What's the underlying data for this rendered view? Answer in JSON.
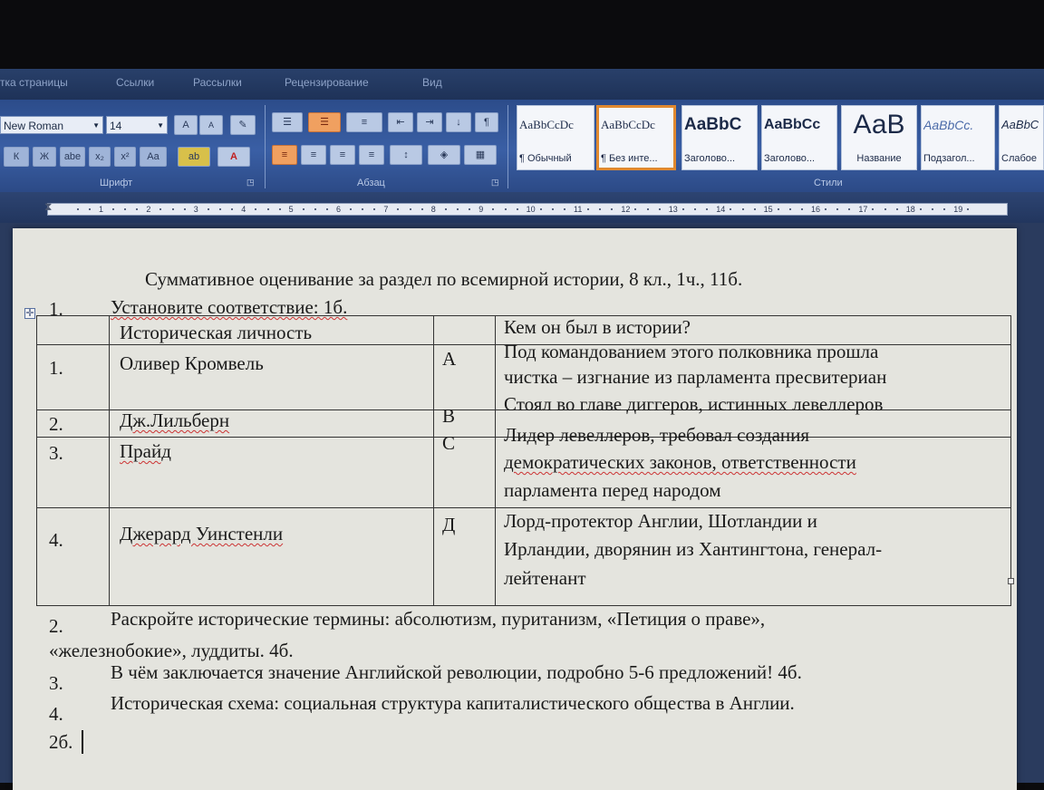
{
  "ribbon": {
    "tabs": [
      "тка страницы",
      "Ссылки",
      "Рассылки",
      "Рецензирование",
      "Вид"
    ],
    "font": {
      "name": "New Roman",
      "size": "14",
      "grow_label": "A",
      "shrink_label": "A",
      "format_buttons": [
        "Ж",
        "К",
        "abe",
        "x₂",
        "x²",
        "Aa"
      ],
      "highlight_label": "ab",
      "color_label": "A",
      "group_label": "Шрифт"
    },
    "paragraph": {
      "group_label": "Абзац"
    },
    "styles": {
      "group_label": "Стили",
      "items": [
        {
          "preview": "AaBbCcDc",
          "name": "¶ Обычный"
        },
        {
          "preview": "AaBbCcDc",
          "name": "¶ Без инте..."
        },
        {
          "preview": "AaBbC",
          "name": "Заголово..."
        },
        {
          "preview": "AaBbCc",
          "name": "Заголово..."
        },
        {
          "preview": "АаВ",
          "name": "Название"
        },
        {
          "preview": "AaBbCc.",
          "name": "Подзагол..."
        },
        {
          "preview": "AaBbC",
          "name": "Слабое"
        }
      ]
    }
  },
  "ruler": {
    "numbers": [
      "1",
      "2",
      "3",
      "4",
      "5",
      "6",
      "7",
      "8",
      "9",
      "10",
      "11",
      "12",
      "13",
      "14",
      "15",
      "16",
      "17",
      "18",
      "19"
    ]
  },
  "document": {
    "title": "Суммативное оценивание за раздел по всемирной истории, 8 кл., 1ч., 11б.",
    "task1": {
      "num": "1.",
      "text": "Установите соответствие: 1б."
    },
    "table": {
      "headers": {
        "person": "Историческая личность",
        "role": "Кем он был в истории?"
      },
      "rows": [
        {
          "num": "1.",
          "name": "Оливер Кромвель",
          "letter": "А",
          "desc": [
            "Под командованием этого полковника прошла",
            "чистка – изгнание из парламента пресвитериан"
          ]
        },
        {
          "num": "2.",
          "name": "Дж.Лильберн",
          "letter": "В",
          "desc": [
            "Стоял во главе диггеров, истинных левеллеров"
          ]
        },
        {
          "num": "3.",
          "name": "Прайд",
          "letter": "С",
          "desc": [
            "Лидер левеллеров, требовал создания",
            "демократических законов, ответственности",
            "парламента перед народом"
          ]
        },
        {
          "num": "4.",
          "name": "Джерард Уинстенли",
          "letter": "Д",
          "desc": [
            "Лорд-протектор Англии, Шотландии и",
            "Ирландии, дворянин из Хантингтона, генерал-",
            "лейтенант"
          ]
        }
      ]
    },
    "task2": {
      "num": "2.",
      "line1": "Раскройте исторические термины: абсолютизм, пуританизм, «Петиция о праве»,",
      "line2": "«железнобокие», луддиты. 4б."
    },
    "task3": {
      "num": "3.",
      "text": "В чём заключается значение Английской революции, подробно 5-6 предложений! 4б."
    },
    "task4": {
      "num": "4.",
      "text": "Историческая схема: социальная структура капиталистического общества в Англии.",
      "line2": "2б."
    }
  }
}
